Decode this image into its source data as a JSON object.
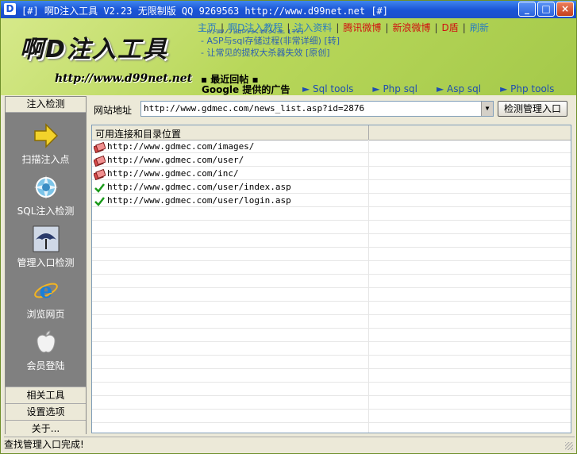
{
  "window": {
    "title": "[#] 啊D注入工具 V2.23 无限制版 QQ 9269563 http://www.d99net.net [#]",
    "app_icon_letter": "D",
    "min_glyph": "_",
    "max_glyph": "□",
    "close_glyph": "×"
  },
  "banner": {
    "logo": "啊D注入工具",
    "url": "http://www.d99net.net",
    "nav": [
      {
        "label": "主页",
        "color": "#2c7fbf"
      },
      {
        "label": "啊D注入教程",
        "color": "#2c7fbf"
      },
      {
        "label": "注入资料",
        "color": "#2c7fbf"
      },
      {
        "label": "腾讯微博",
        "color": "#d01010"
      },
      {
        "label": "新浪微博",
        "color": "#d01010"
      },
      {
        "label": "D盾",
        "color": "#d01010"
      },
      {
        "label": "刷新",
        "color": "#2c7fbf"
      }
    ],
    "nav_sep": "|",
    "news": [
      "- 防御方面的安装安全 [转]",
      "- ASP与sql存储过程(非常详细) [转]",
      "- 让常见的提权大杀器失效 [原创]"
    ],
    "recent_label": "▪ 最近回帖 ▪",
    "ad_label": "Google 提供的广告",
    "tools": [
      "► Sql tools",
      "► Php sql",
      "► Asp sql",
      "► Php tools"
    ]
  },
  "sidebar": {
    "header": "注入检测",
    "items": [
      {
        "label": "扫描注入点",
        "icon": "arrow-icon"
      },
      {
        "label": "SQL注入检测",
        "icon": "syringe-icon"
      },
      {
        "label": "管理入口检测",
        "icon": "umbrella-icon"
      },
      {
        "label": "浏览网页",
        "icon": "ie-icon"
      },
      {
        "label": "会员登陆",
        "icon": "apple-icon"
      }
    ],
    "footer": [
      "相关工具",
      "设置选项",
      "关于..."
    ]
  },
  "main": {
    "url_label": "网站地址",
    "url_value": "http://www.gdmec.com/news_list.asp?id=2876",
    "detect_button": "检测管理入口",
    "list_header": "可用连接和目录位置",
    "rows": [
      {
        "url": "http://www.gdmec.com/images/",
        "status": "folder"
      },
      {
        "url": "http://www.gdmec.com/user/",
        "status": "folder"
      },
      {
        "url": "http://www.gdmec.com/inc/",
        "status": "folder"
      },
      {
        "url": "http://www.gdmec.com/user/index.asp",
        "status": "ok"
      },
      {
        "url": "http://www.gdmec.com/user/login.asp",
        "status": "ok"
      }
    ]
  },
  "status": {
    "text": "查找管理入口完成!"
  },
  "colors": {
    "titlebar": "#1953d6",
    "banner": "#b8d75a",
    "sidebar": "#808080",
    "check": "#1a9a1a",
    "folder_mark": "#d84a4a"
  }
}
